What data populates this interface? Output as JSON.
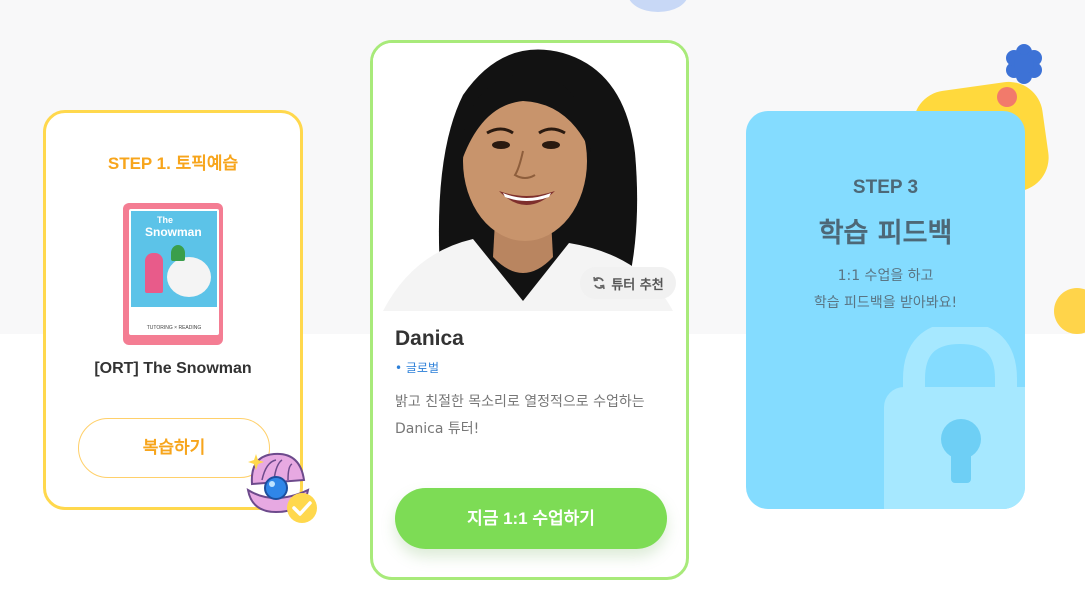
{
  "step1": {
    "title": "STEP 1. 토픽예습",
    "book_cover_title_small": "The",
    "book_cover_title": "Snowman",
    "book_footer": "TUTORING × READING",
    "book_label": "[ORT] The Snowman",
    "review_button": "복습하기"
  },
  "step2": {
    "recommend_badge": "튜터 추천",
    "tutor_name": "Danica",
    "tutor_tag": "• 글로벌",
    "tutor_desc": "밝고 친절한 목소리로 열정적으로 수업하는 Danica 튜터!",
    "start_button": "지금 1:1 수업하기"
  },
  "step3": {
    "label": "STEP 3",
    "title": "학습 피드백",
    "desc_line1": "1:1 수업을 하고",
    "desc_line2": "학습 피드백을 받아봐요!"
  },
  "colors": {
    "step1_border": "#ffd84d",
    "step1_accent": "#f7a51c",
    "step2_border": "#a8ea7a",
    "start_button": "#7ddc55",
    "step3_bg": "#84dcff",
    "tag_blue": "#2c7fd8"
  },
  "icons": {
    "recommend": "refresh-icon",
    "locked": "lock-icon",
    "completed": "check-circle-icon",
    "clam": "clam-pearl-icon"
  }
}
